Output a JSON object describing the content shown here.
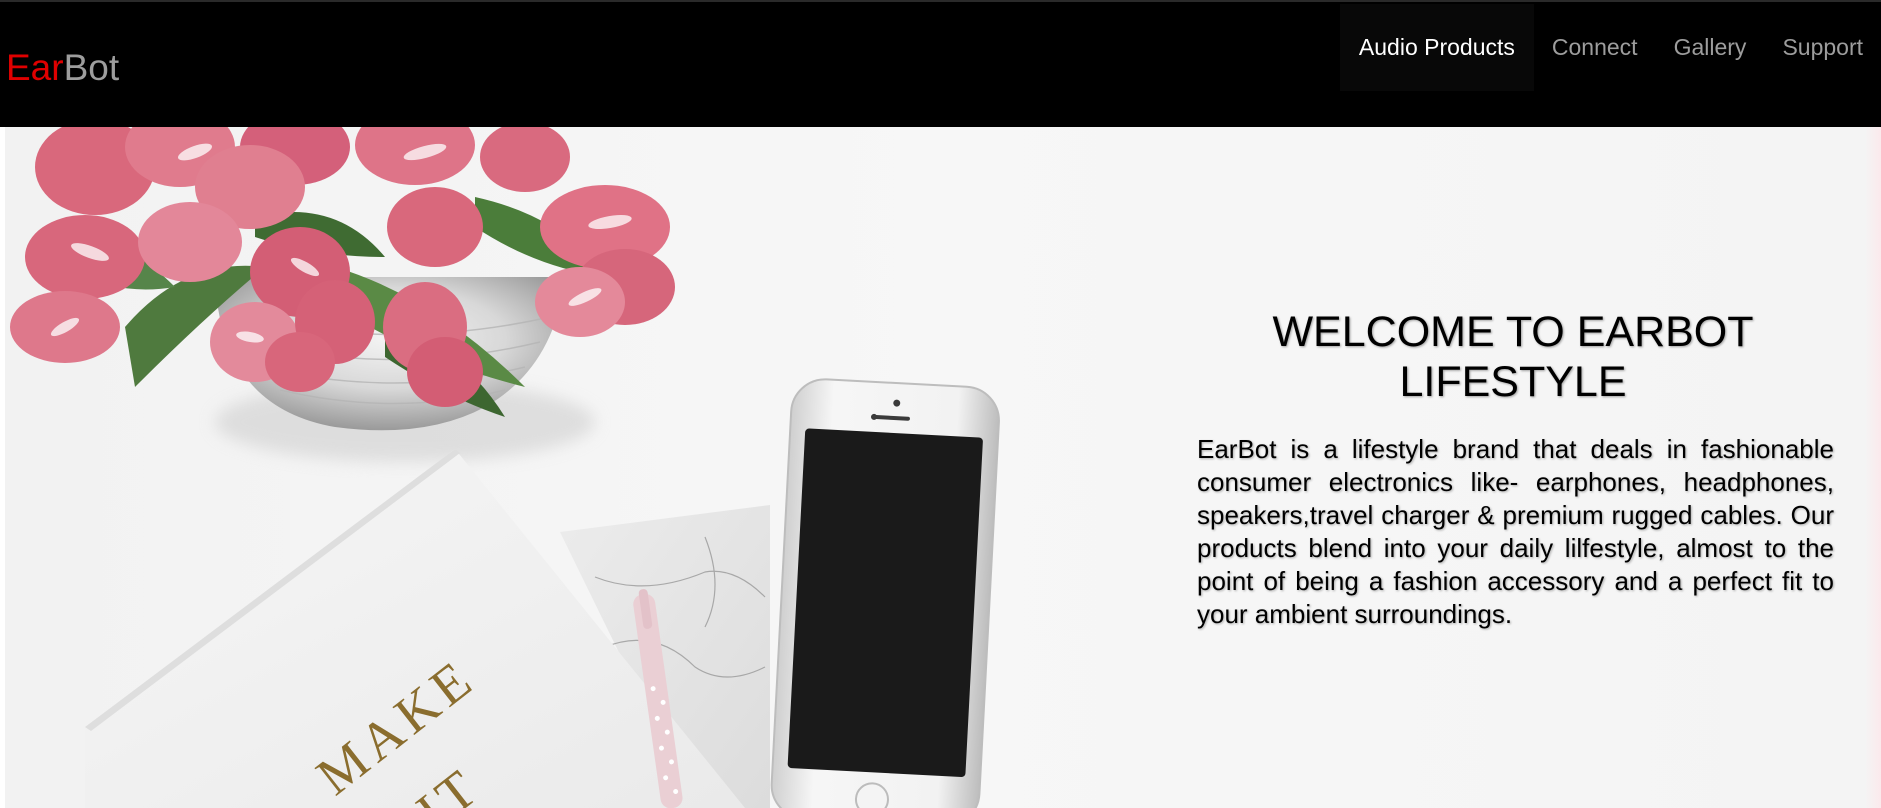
{
  "brand": {
    "part1": "Ear",
    "part2": "Bot",
    "part1_color": "#e00000",
    "part2_color": "#9d9d9d"
  },
  "nav": {
    "items": [
      {
        "label": "Audio Products",
        "active": true
      },
      {
        "label": "Connect",
        "active": false
      },
      {
        "label": "Gallery",
        "active": false
      },
      {
        "label": "Support",
        "active": false
      }
    ]
  },
  "hero": {
    "heading": "WELCOME TO EARBOT LIFESTYLE",
    "description": "EarBot is a lifestyle brand that deals in fashionable consumer electronics like- earphones, headphones, speakers,travel charger & premium rugged cables. Our products blend into your daily lilfestyle, almost to the point of being a fashion accessory and a perfect fit to your ambient surroundings.",
    "notebook_text": "MAKE IT"
  },
  "colors": {
    "navbar_bg": "#000000",
    "nav_text": "#9d9d9d",
    "nav_active_text": "#ffffff",
    "tulip_pink": "#d9687c",
    "leaf_green": "#4f7a3e",
    "gold_text": "#8a6d2e"
  },
  "icons": {
    "hero_image": "tulips-phone-notebook-photo"
  }
}
